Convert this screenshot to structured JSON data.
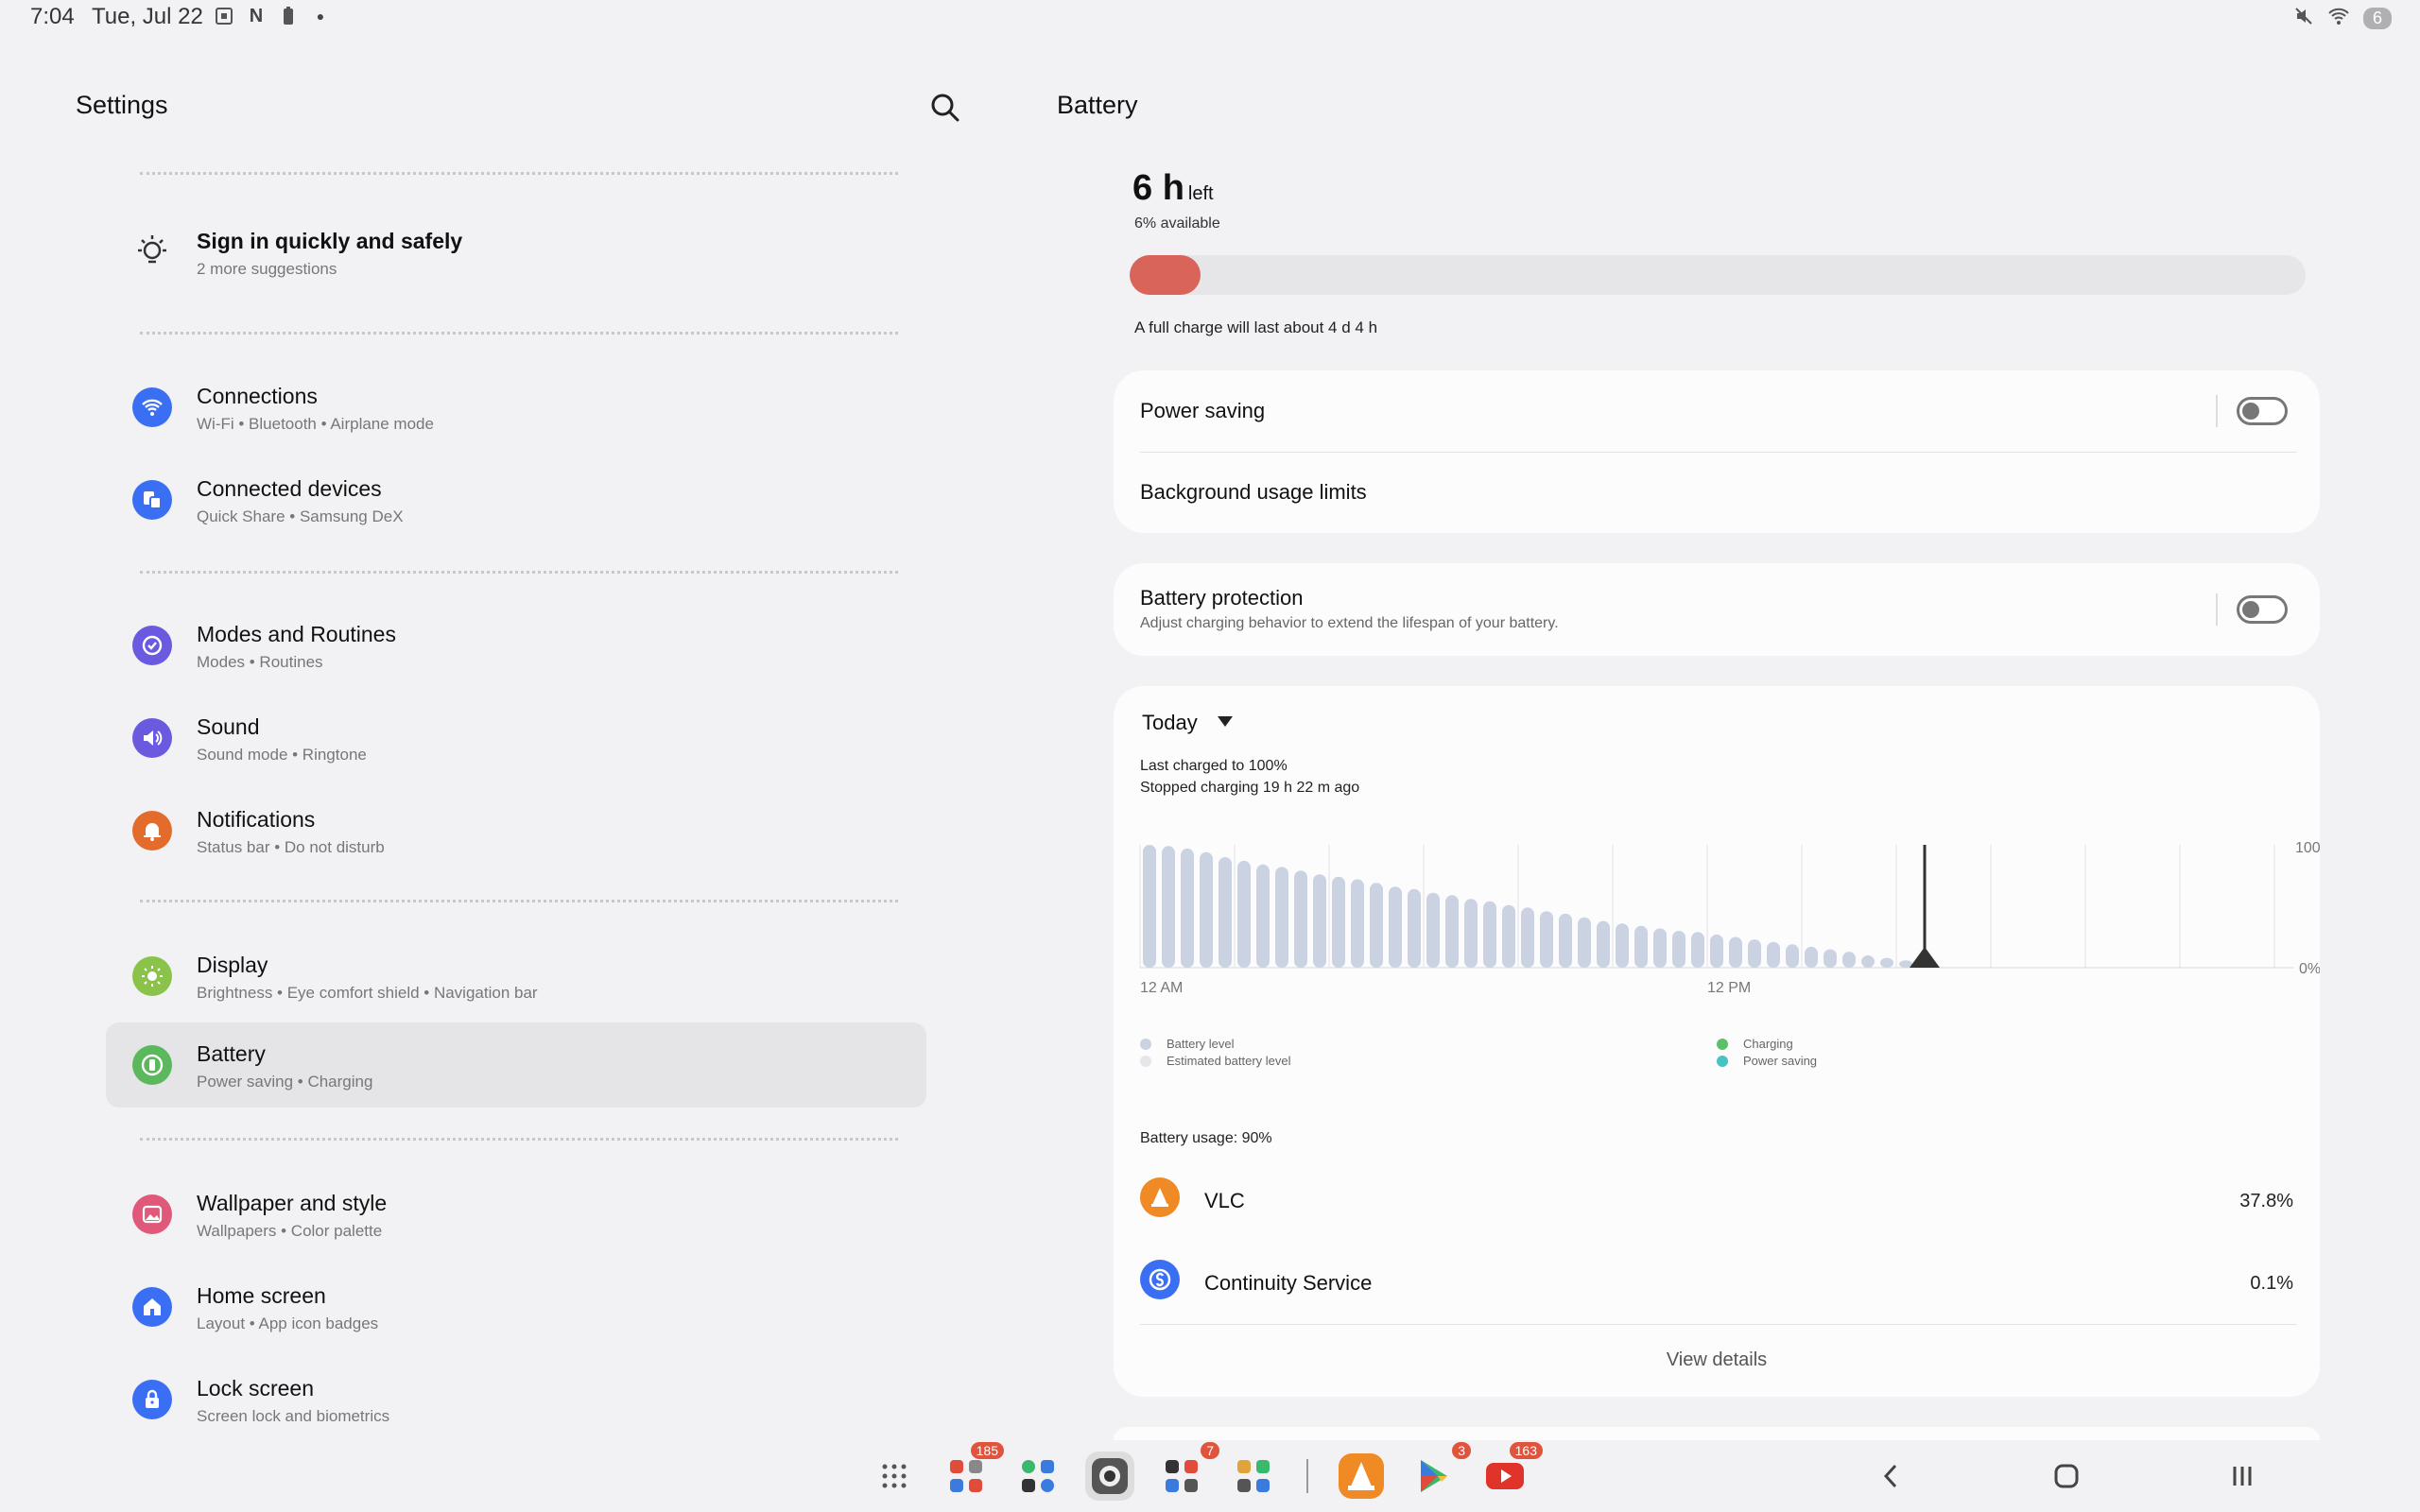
{
  "status_bar": {
    "time": "7:04",
    "date": "Tue, Jul 22",
    "icons": [
      "screenshot-icon",
      "n-icon",
      "battery-saver-icon",
      "dot-icon"
    ],
    "right_icons": [
      "mute-icon",
      "wifi-icon"
    ],
    "battery_level": "6"
  },
  "left": {
    "title": "Settings",
    "suggestion": {
      "title": "Sign in quickly and safely",
      "subtitle": "2 more suggestions"
    },
    "items": [
      {
        "title": "Connections",
        "subtitle": "Wi-Fi  •  Bluetooth  •  Airplane mode",
        "icon": "wifi-icon",
        "color": "#3b6ff3"
      },
      {
        "title": "Connected devices",
        "subtitle": "Quick Share  •  Samsung DeX",
        "icon": "devices-icon",
        "color": "#3b6ff3"
      },
      {
        "title": "Modes and Routines",
        "subtitle": "Modes  •  Routines",
        "icon": "routines-icon",
        "color": "#6a5adf"
      },
      {
        "title": "Sound",
        "subtitle": "Sound mode  •  Ringtone",
        "icon": "speaker-icon",
        "color": "#6a5adf"
      },
      {
        "title": "Notifications",
        "subtitle": "Status bar  •  Do not disturb",
        "icon": "bell-icon",
        "color": "#e36b2c"
      },
      {
        "title": "Display",
        "subtitle": "Brightness  •  Eye comfort shield  •  Navigation bar",
        "icon": "sun-icon",
        "color": "#8bc34a"
      },
      {
        "title": "Battery",
        "subtitle": "Power saving  •  Charging",
        "icon": "battery-icon",
        "color": "#5cb85c"
      },
      {
        "title": "Wallpaper and style",
        "subtitle": "Wallpapers  •  Color palette",
        "icon": "image-icon",
        "color": "#e0587a"
      },
      {
        "title": "Home screen",
        "subtitle": "Layout  •  App icon badges",
        "icon": "home-icon",
        "color": "#3b6ff3"
      },
      {
        "title": "Lock screen",
        "subtitle": "Screen lock and biometrics",
        "icon": "lock-icon",
        "color": "#3b6ff3"
      }
    ]
  },
  "right": {
    "title": "Battery",
    "hours": "6 h",
    "hours_unit": "left",
    "available": "6% available",
    "level_percent": 6,
    "full_charge": "A full charge will last about 4 d 4 h",
    "power_saving": "Power saving",
    "power_saving_on": false,
    "background_limits": "Background usage limits",
    "protection_title": "Battery protection",
    "protection_sub": "Adjust charging behavior to extend the lifespan of your battery.",
    "protection_on": false,
    "period": "Today",
    "last_charged": "Last charged to 100%",
    "stopped_charging": "Stopped charging 19 h 22 m ago",
    "usage_label": "Battery usage: 90%",
    "apps": [
      {
        "name": "VLC",
        "percent": "37.8%",
        "icon": "vlc-icon",
        "color": "#f08a24"
      },
      {
        "name": "Continuity Service",
        "percent": "0.1%",
        "icon": "continuity-icon",
        "color": "#3b6ff3"
      }
    ],
    "view_details": "View details"
  },
  "chart_data": {
    "type": "bar",
    "x_labels": [
      "12 AM",
      "12 PM"
    ],
    "y_labels": [
      "100",
      "0%"
    ],
    "ylim": [
      0,
      100
    ],
    "series": [
      {
        "name": "Battery level",
        "values": [
          100,
          99,
          97,
          94,
          90,
          87,
          84,
          82,
          79,
          76,
          74,
          72,
          69,
          66,
          64,
          61,
          59,
          56,
          54,
          51,
          49,
          46,
          44,
          41,
          38,
          36,
          34,
          32,
          30,
          29,
          27,
          25,
          23,
          21,
          19,
          17,
          15,
          13,
          10,
          8,
          6
        ]
      }
    ],
    "marker_index": 41,
    "legend": [
      {
        "label": "Battery level",
        "color": "#cbd3e3"
      },
      {
        "label": "Estimated battery level",
        "color": "#e6e6ea"
      },
      {
        "label": "Charging",
        "color": "#5cc06a"
      },
      {
        "label": "Power saving",
        "color": "#46c4c2"
      }
    ]
  },
  "taskbar": {
    "apps": [
      {
        "icon": "apps-grid-icon",
        "badge": ""
      },
      {
        "icon": "folder-1-icon",
        "badge": "185"
      },
      {
        "icon": "folder-2-icon",
        "badge": ""
      },
      {
        "icon": "camera-icon",
        "badge": ""
      },
      {
        "icon": "folder-3-icon",
        "badge": "7"
      },
      {
        "icon": "folder-4-icon",
        "badge": ""
      },
      {
        "icon": "vlc-icon",
        "badge": ""
      },
      {
        "icon": "play-store-icon",
        "badge": "3"
      },
      {
        "icon": "youtube-icon",
        "badge": "163"
      }
    ]
  }
}
